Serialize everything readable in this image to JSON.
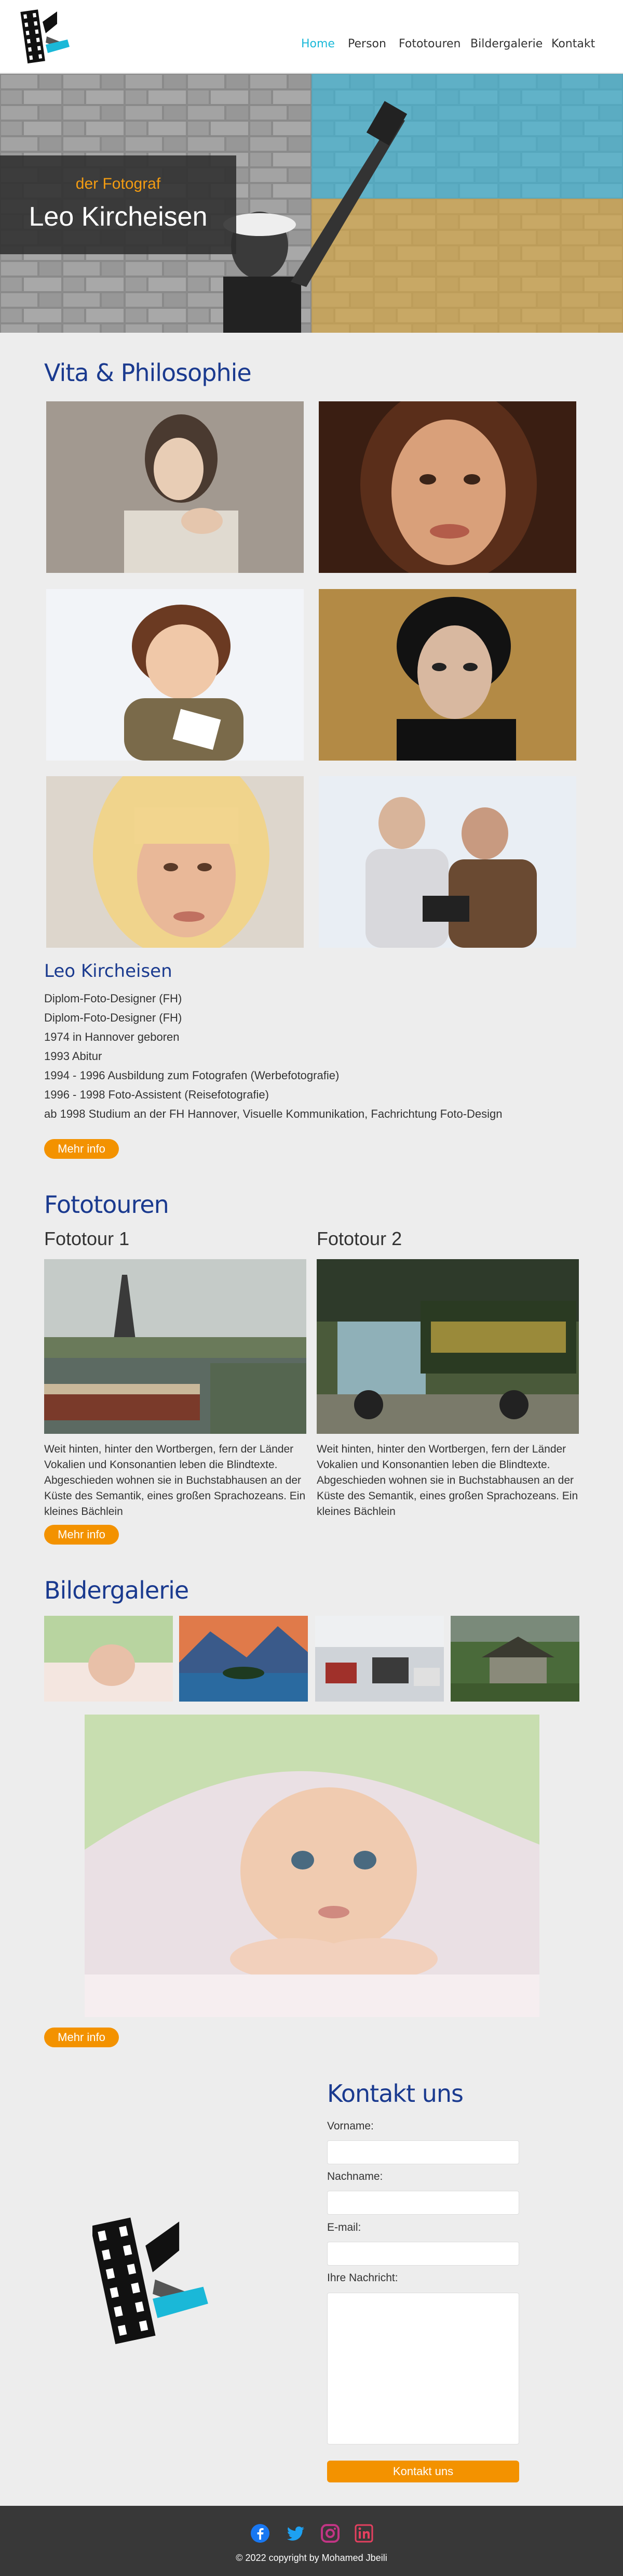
{
  "nav": {
    "items": [
      {
        "label": "Home",
        "active": true
      },
      {
        "label": "Person",
        "active": false
      },
      {
        "label": "Fototouren",
        "active": false
      },
      {
        "label": "Bildergalerie",
        "active": false
      },
      {
        "label": "Kontakt",
        "active": false
      }
    ]
  },
  "hero": {
    "subtitle": "der Fotograf",
    "title": "Leo Kircheisen"
  },
  "vita": {
    "heading": "Vita & Philosophie",
    "name": "Leo Kircheisen",
    "lines": [
      "Diplom-Foto-Designer (FH)",
      "Diplom-Foto-Designer (FH)",
      "1974 in Hannover geboren",
      "1993 Abitur",
      "1994 - 1996 Ausbildung zum Fotografen (Werbefotografie)",
      "1996 - 1998 Foto-Assistent (Reisefotografie)",
      "ab 1998 Studium an der FH Hannover, Visuelle Kommunikation, Fachrichtung Foto-Design"
    ],
    "more_label": "Mehr info"
  },
  "tours": {
    "heading": "Fototouren",
    "items": [
      {
        "title": "Fototour 1",
        "text": "Weit hinten, hinter den Wortbergen, fern der Länder Vokalien und Konsonantien leben die Blindtexte. Abgeschieden wohnen sie in Buchstabhausen an der Küste des Semantik, eines großen Sprachozeans. Ein kleines Bächlein"
      },
      {
        "title": "Fototour 2",
        "text": "Weit hinten, hinter den Wortbergen, fern der Länder Vokalien und Konsonantien leben die Blindtexte. Abgeschieden wohnen sie in Buchstabhausen an der Küste des Semantik, eines großen Sprachozeans. Ein kleines Bächlein"
      }
    ],
    "more_label": "Mehr info"
  },
  "gallery": {
    "heading": "Bildergalerie",
    "more_label": "Mehr info"
  },
  "contact": {
    "heading": "Kontakt uns",
    "firstname_label": "Vorname:",
    "lastname_label": "Nachname:",
    "email_label": "E-mail:",
    "message_label": "Ihre Nachricht:",
    "submit_label": "Kontakt uns"
  },
  "footer": {
    "copyright": "© 2022 copyright by Mohamed Jbeili"
  },
  "colors": {
    "accent": "#f39200",
    "heading": "#1a3a8f",
    "nav_active": "#1ab8d8",
    "footer_bg": "#383838"
  },
  "icons": [
    "film-logo-icon",
    "facebook-icon",
    "twitter-icon",
    "instagram-icon",
    "linkedin-icon"
  ]
}
